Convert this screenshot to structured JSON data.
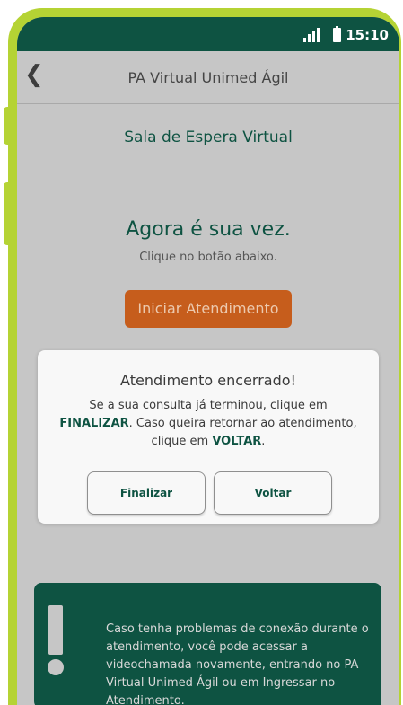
{
  "status_bar": {
    "time": "15:10"
  },
  "header": {
    "title": "PA Virtual Unimed Ágil"
  },
  "waiting_room": {
    "title": "Sala de Espera Virtual",
    "headline": "Agora é sua vez.",
    "subtitle": "Clique no botão abaixo.",
    "start_button": "Iniciar Atendimento"
  },
  "modal": {
    "title": "Atendimento encerrado!",
    "text_part1": "Se a sua consulta já terminou, clique em ",
    "keyword1": "FINALIZAR",
    "text_part2": ". Caso queira retornar ao atendimento, clique em ",
    "keyword2": "VOLTAR",
    "text_part3": ".",
    "finalize_button": "Finalizar",
    "back_button": "Voltar"
  },
  "info_box": {
    "text": "Caso tenha problemas de conexão durante o atendimento, você pode acessar a videochamada novamente, entrando no PA Virtual Unimed Ágil ou em Ingressar no Atendimento."
  },
  "colors": {
    "accent_green": "#0e5342",
    "frame_lime": "#b5d334",
    "start_orange": "#c65d1c"
  }
}
